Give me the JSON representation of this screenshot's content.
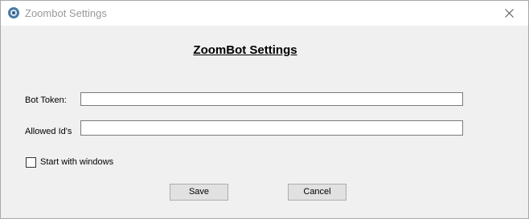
{
  "window": {
    "title": "Zoombot Settings"
  },
  "form": {
    "heading": "ZoomBot Settings",
    "bot_token_label": "Bot Token:",
    "bot_token_value": "",
    "allowed_ids_label": "Allowed Id's",
    "allowed_ids_value": "",
    "start_with_windows_label": "Start with windows",
    "start_with_windows_checked": false
  },
  "buttons": {
    "save_label": "Save",
    "cancel_label": "Cancel"
  },
  "icons": {
    "app": "zoombot-app-icon",
    "close": "close-icon"
  },
  "colors": {
    "window_bg": "#f0f0f0",
    "titlebar_bg": "#ffffff",
    "button_bg": "#e1e1e1"
  }
}
